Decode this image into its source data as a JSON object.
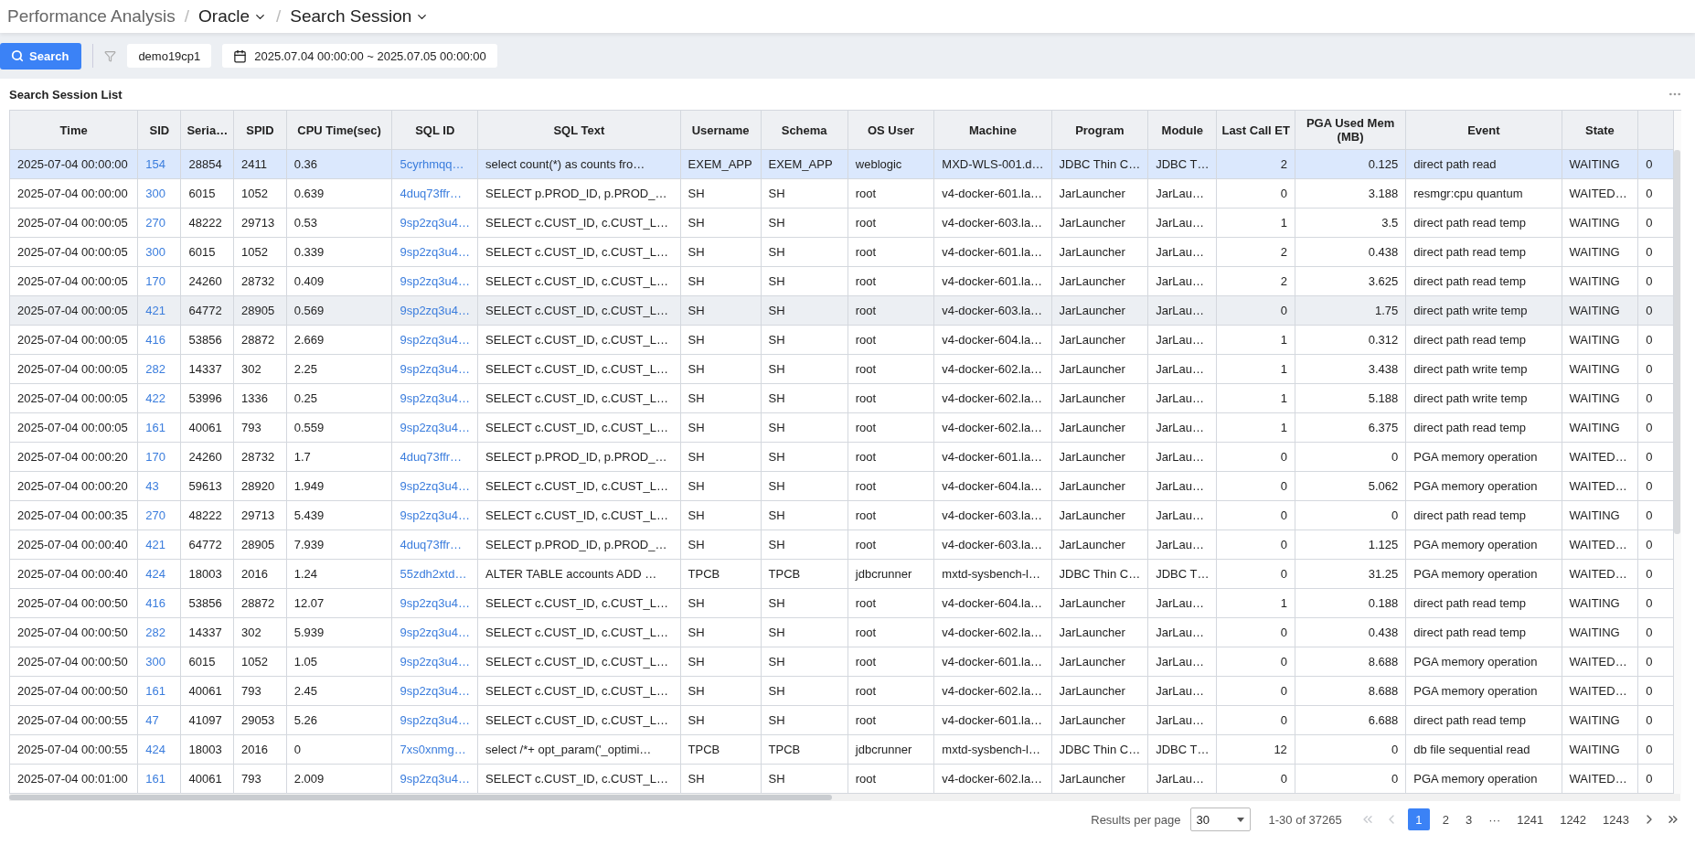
{
  "breadcrumb": {
    "root": "Performance Analysis",
    "items": [
      {
        "separator": "/",
        "label": "Oracle",
        "dropdown": true
      },
      {
        "separator": "/",
        "label": "Search Session",
        "dropdown": true
      }
    ]
  },
  "toolbar": {
    "search_button": "Search",
    "instance": "demo19cp1",
    "date_range": "2025.07.04 00:00:00 ~ 2025.07.05 00:00:00"
  },
  "panel": {
    "title": "Search Session List",
    "table": {
      "columns": [
        {
          "label": "Time",
          "kind": "text"
        },
        {
          "label": "SID",
          "kind": "link"
        },
        {
          "label": "Seria…",
          "kind": "text"
        },
        {
          "label": "SPID",
          "kind": "text"
        },
        {
          "label": "CPU Time(sec)",
          "kind": "text"
        },
        {
          "label": "SQL ID",
          "kind": "link"
        },
        {
          "label": "SQL Text",
          "kind": "text"
        },
        {
          "label": "Username",
          "kind": "text"
        },
        {
          "label": "Schema",
          "kind": "text"
        },
        {
          "label": "OS User",
          "kind": "text"
        },
        {
          "label": "Machine",
          "kind": "text"
        },
        {
          "label": "Program",
          "kind": "text"
        },
        {
          "label": "Module",
          "kind": "text"
        },
        {
          "label": "Last Call ET",
          "kind": "number"
        },
        {
          "label": "PGA Used Mem (MB)",
          "kind": "number"
        },
        {
          "label": "Event",
          "kind": "text"
        },
        {
          "label": "State",
          "kind": "text"
        },
        {
          "kind": "text"
        }
      ],
      "rows": [
        {
          "selected": true,
          "hovered": false,
          "cells": [
            "2025-07-04 00:00:00",
            "154",
            "28854",
            "2411",
            "0.36",
            "5cyrhmqq…",
            "select count(*) as counts fro…",
            "EXEM_APP",
            "EXEM_APP",
            "weblogic",
            "MXD-WLS-001.d…",
            "JDBC Thin C…",
            "JDBC T…",
            "2",
            "0.125",
            "direct path read",
            "WAITING",
            "0"
          ]
        },
        {
          "selected": false,
          "hovered": false,
          "cells": [
            "2025-07-04 00:00:00",
            "300",
            "6015",
            "1052",
            "0.639",
            "4duq73ffr…",
            "SELECT p.PROD_ID, p.PROD_…",
            "SH",
            "SH",
            "root",
            "v4-docker-601.la…",
            "JarLauncher",
            "JarLau…",
            "0",
            "3.188",
            "resmgr:cpu quantum",
            "WAITED…",
            "0"
          ]
        },
        {
          "selected": false,
          "hovered": false,
          "cells": [
            "2025-07-04 00:00:05",
            "270",
            "48222",
            "29713",
            "0.53",
            "9sp2zq3u4…",
            "SELECT c.CUST_ID, c.CUST_L…",
            "SH",
            "SH",
            "root",
            "v4-docker-603.la…",
            "JarLauncher",
            "JarLau…",
            "1",
            "3.5",
            "direct path read temp",
            "WAITING",
            "0"
          ]
        },
        {
          "selected": false,
          "hovered": false,
          "cells": [
            "2025-07-04 00:00:05",
            "300",
            "6015",
            "1052",
            "0.339",
            "9sp2zq3u4…",
            "SELECT c.CUST_ID, c.CUST_L…",
            "SH",
            "SH",
            "root",
            "v4-docker-601.la…",
            "JarLauncher",
            "JarLau…",
            "2",
            "0.438",
            "direct path read temp",
            "WAITING",
            "0"
          ]
        },
        {
          "selected": false,
          "hovered": false,
          "cells": [
            "2025-07-04 00:00:05",
            "170",
            "24260",
            "28732",
            "0.409",
            "9sp2zq3u4…",
            "SELECT c.CUST_ID, c.CUST_L…",
            "SH",
            "SH",
            "root",
            "v4-docker-601.la…",
            "JarLauncher",
            "JarLau…",
            "2",
            "3.625",
            "direct path read temp",
            "WAITING",
            "0"
          ]
        },
        {
          "selected": false,
          "hovered": true,
          "cells": [
            "2025-07-04 00:00:05",
            "421",
            "64772",
            "28905",
            "0.569",
            "9sp2zq3u4…",
            "SELECT c.CUST_ID, c.CUST_L…",
            "SH",
            "SH",
            "root",
            "v4-docker-603.la…",
            "JarLauncher",
            "JarLau…",
            "0",
            "1.75",
            "direct path write temp",
            "WAITING",
            "0"
          ]
        },
        {
          "selected": false,
          "hovered": false,
          "cells": [
            "2025-07-04 00:00:05",
            "416",
            "53856",
            "28872",
            "2.669",
            "9sp2zq3u4…",
            "SELECT c.CUST_ID, c.CUST_L…",
            "SH",
            "SH",
            "root",
            "v4-docker-604.la…",
            "JarLauncher",
            "JarLau…",
            "1",
            "0.312",
            "direct path read temp",
            "WAITING",
            "0"
          ]
        },
        {
          "selected": false,
          "hovered": false,
          "cells": [
            "2025-07-04 00:00:05",
            "282",
            "14337",
            "302",
            "2.25",
            "9sp2zq3u4…",
            "SELECT c.CUST_ID, c.CUST_L…",
            "SH",
            "SH",
            "root",
            "v4-docker-602.la…",
            "JarLauncher",
            "JarLau…",
            "1",
            "3.438",
            "direct path write temp",
            "WAITING",
            "0"
          ]
        },
        {
          "selected": false,
          "hovered": false,
          "cells": [
            "2025-07-04 00:00:05",
            "422",
            "53996",
            "1336",
            "0.25",
            "9sp2zq3u4…",
            "SELECT c.CUST_ID, c.CUST_L…",
            "SH",
            "SH",
            "root",
            "v4-docker-602.la…",
            "JarLauncher",
            "JarLau…",
            "1",
            "5.188",
            "direct path write temp",
            "WAITING",
            "0"
          ]
        },
        {
          "selected": false,
          "hovered": false,
          "cells": [
            "2025-07-04 00:00:05",
            "161",
            "40061",
            "793",
            "0.559",
            "9sp2zq3u4…",
            "SELECT c.CUST_ID, c.CUST_L…",
            "SH",
            "SH",
            "root",
            "v4-docker-602.la…",
            "JarLauncher",
            "JarLau…",
            "1",
            "6.375",
            "direct path read temp",
            "WAITING",
            "0"
          ]
        },
        {
          "selected": false,
          "hovered": false,
          "cells": [
            "2025-07-04 00:00:20",
            "170",
            "24260",
            "28732",
            "1.7",
            "4duq73ffr…",
            "SELECT p.PROD_ID, p.PROD_…",
            "SH",
            "SH",
            "root",
            "v4-docker-601.la…",
            "JarLauncher",
            "JarLau…",
            "0",
            "0",
            "PGA memory operation",
            "WAITED…",
            "0"
          ]
        },
        {
          "selected": false,
          "hovered": false,
          "cells": [
            "2025-07-04 00:00:20",
            "43",
            "59613",
            "28920",
            "1.949",
            "9sp2zq3u4…",
            "SELECT c.CUST_ID, c.CUST_L…",
            "SH",
            "SH",
            "root",
            "v4-docker-604.la…",
            "JarLauncher",
            "JarLau…",
            "0",
            "5.062",
            "PGA memory operation",
            "WAITED…",
            "0"
          ]
        },
        {
          "selected": false,
          "hovered": false,
          "cells": [
            "2025-07-04 00:00:35",
            "270",
            "48222",
            "29713",
            "5.439",
            "9sp2zq3u4…",
            "SELECT c.CUST_ID, c.CUST_L…",
            "SH",
            "SH",
            "root",
            "v4-docker-603.la…",
            "JarLauncher",
            "JarLau…",
            "0",
            "0",
            "direct path read temp",
            "WAITING",
            "0"
          ]
        },
        {
          "selected": false,
          "hovered": false,
          "cells": [
            "2025-07-04 00:00:40",
            "421",
            "64772",
            "28905",
            "7.939",
            "4duq73ffr…",
            "SELECT p.PROD_ID, p.PROD_…",
            "SH",
            "SH",
            "root",
            "v4-docker-603.la…",
            "JarLauncher",
            "JarLau…",
            "0",
            "1.125",
            "PGA memory operation",
            "WAITED…",
            "0"
          ]
        },
        {
          "selected": false,
          "hovered": false,
          "cells": [
            "2025-07-04 00:00:40",
            "424",
            "18003",
            "2016",
            "1.24",
            "55zdh2xtd…",
            "ALTER TABLE accounts ADD …",
            "TPCB",
            "TPCB",
            "jdbcrunner",
            "mxtd-sysbench-l…",
            "JDBC Thin C…",
            "JDBC T…",
            "0",
            "31.25",
            "PGA memory operation",
            "WAITED…",
            "0"
          ]
        },
        {
          "selected": false,
          "hovered": false,
          "cells": [
            "2025-07-04 00:00:50",
            "416",
            "53856",
            "28872",
            "12.07",
            "9sp2zq3u4…",
            "SELECT c.CUST_ID, c.CUST_L…",
            "SH",
            "SH",
            "root",
            "v4-docker-604.la…",
            "JarLauncher",
            "JarLau…",
            "1",
            "0.188",
            "direct path read temp",
            "WAITING",
            "0"
          ]
        },
        {
          "selected": false,
          "hovered": false,
          "cells": [
            "2025-07-04 00:00:50",
            "282",
            "14337",
            "302",
            "5.939",
            "9sp2zq3u4…",
            "SELECT c.CUST_ID, c.CUST_L…",
            "SH",
            "SH",
            "root",
            "v4-docker-602.la…",
            "JarLauncher",
            "JarLau…",
            "0",
            "0.438",
            "direct path read temp",
            "WAITING",
            "0"
          ]
        },
        {
          "selected": false,
          "hovered": false,
          "cells": [
            "2025-07-04 00:00:50",
            "300",
            "6015",
            "1052",
            "1.05",
            "9sp2zq3u4…",
            "SELECT c.CUST_ID, c.CUST_L…",
            "SH",
            "SH",
            "root",
            "v4-docker-601.la…",
            "JarLauncher",
            "JarLau…",
            "0",
            "8.688",
            "PGA memory operation",
            "WAITED…",
            "0"
          ]
        },
        {
          "selected": false,
          "hovered": false,
          "cells": [
            "2025-07-04 00:00:50",
            "161",
            "40061",
            "793",
            "2.45",
            "9sp2zq3u4…",
            "SELECT c.CUST_ID, c.CUST_L…",
            "SH",
            "SH",
            "root",
            "v4-docker-602.la…",
            "JarLauncher",
            "JarLau…",
            "0",
            "8.688",
            "PGA memory operation",
            "WAITED…",
            "0"
          ]
        },
        {
          "selected": false,
          "hovered": false,
          "cells": [
            "2025-07-04 00:00:55",
            "47",
            "41097",
            "29053",
            "5.26",
            "9sp2zq3u4…",
            "SELECT c.CUST_ID, c.CUST_L…",
            "SH",
            "SH",
            "root",
            "v4-docker-601.la…",
            "JarLauncher",
            "JarLau…",
            "0",
            "6.688",
            "direct path read temp",
            "WAITING",
            "0"
          ]
        },
        {
          "selected": false,
          "hovered": false,
          "cells": [
            "2025-07-04 00:00:55",
            "424",
            "18003",
            "2016",
            "0",
            "7xs0xnmg…",
            "select /*+ opt_param('_optimi…",
            "TPCB",
            "TPCB",
            "jdbcrunner",
            "mxtd-sysbench-l…",
            "JDBC Thin C…",
            "JDBC T…",
            "12",
            "0",
            "db file sequential read",
            "WAITING",
            "0"
          ]
        },
        {
          "selected": false,
          "hovered": false,
          "cells": [
            "2025-07-04 00:01:00",
            "161",
            "40061",
            "793",
            "2.009",
            "9sp2zq3u4…",
            "SELECT c.CUST_ID, c.CUST_L…",
            "SH",
            "SH",
            "root",
            "v4-docker-602.la…",
            "JarLauncher",
            "JarLau…",
            "0",
            "0",
            "PGA memory operation",
            "WAITED…",
            "0"
          ]
        }
      ]
    }
  },
  "pagination": {
    "per_page_label": "Results per page",
    "per_page": "30",
    "range": "1-30 of 37265",
    "first_disabled": true,
    "prev_disabled": true,
    "pages": [
      {
        "label": "1",
        "selected": true
      },
      {
        "label": "2",
        "selected": false
      },
      {
        "label": "3",
        "selected": false
      },
      {
        "label": "···",
        "selected": false
      },
      {
        "label": "1241",
        "selected": false
      },
      {
        "label": "1242",
        "selected": false
      },
      {
        "label": "1243",
        "selected": false
      }
    ]
  }
}
